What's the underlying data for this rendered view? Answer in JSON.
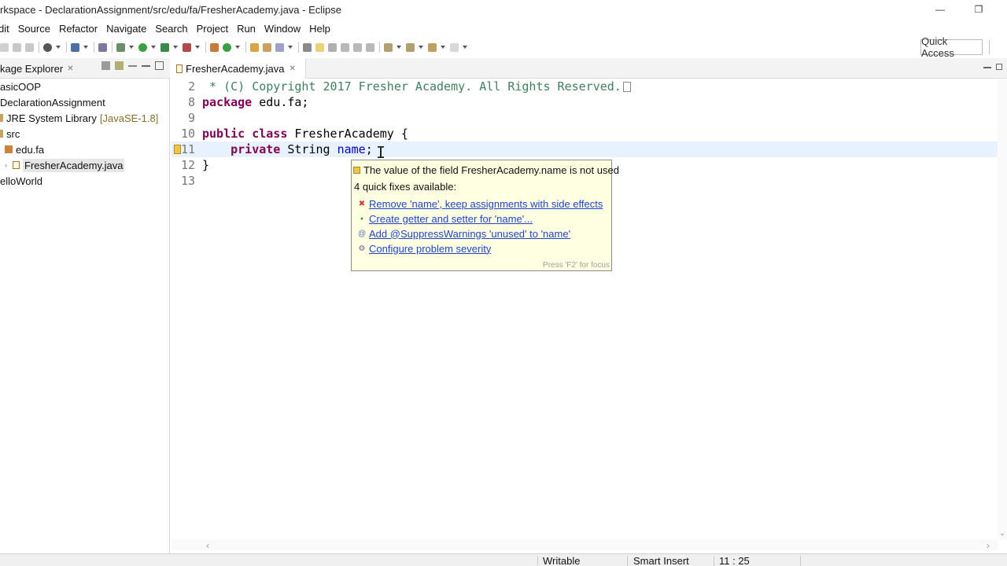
{
  "window": {
    "title": "rkspace - DeclarationAssignment/src/edu/fa/FresherAcademy.java - Eclipse",
    "minimize_glyph": "—",
    "restore_glyph": "❐"
  },
  "menu": [
    "dit",
    "Source",
    "Refactor",
    "Navigate",
    "Search",
    "Project",
    "Run",
    "Window",
    "Help"
  ],
  "toolbar": {
    "quick_access": "Quick Access"
  },
  "package_explorer": {
    "title": "kage Explorer",
    "close_glyph": "✕",
    "items": [
      {
        "label": "asicOOP",
        "extra": ""
      },
      {
        "label": "DeclarationAssignment",
        "extra": ""
      },
      {
        "label": "JRE System Library",
        "extra": "[JavaSE-1.8]"
      },
      {
        "label": "src",
        "extra": ""
      },
      {
        "label": "edu.fa",
        "extra": ""
      },
      {
        "label": "FresherAcademy.java",
        "extra": ""
      },
      {
        "label": "elloWorld",
        "extra": ""
      }
    ]
  },
  "editor": {
    "tab_label": "FresherAcademy.java",
    "close_glyph": "✕",
    "lines": [
      {
        "num": "2",
        "text": " * (C) Copyright 2017 Fresher Academy. All Rights Reserved."
      },
      {
        "num": "8",
        "kw": "package",
        "text": " edu.fa;"
      },
      {
        "num": "9",
        "text": ""
      },
      {
        "num": "10",
        "kw": "public class",
        "text": " FresherAcademy {"
      },
      {
        "num": "11",
        "kw": "private",
        "text": " String ",
        "field": "name",
        "after": ";"
      },
      {
        "num": "12",
        "text": "}"
      },
      {
        "num": "13",
        "text": ""
      }
    ]
  },
  "hover": {
    "message": "The value of the field FresherAcademy.name is not used",
    "count": "4 quick fixes available:",
    "fixes": [
      {
        "label": "Remove 'name', keep assignments with side effects",
        "icon": "remove-icon",
        "glyph": "✖",
        "color": "#d23a3a"
      },
      {
        "label": "Create getter and setter for 'name'...",
        "icon": "method-icon",
        "glyph": "●",
        "color": "#3aa043"
      },
      {
        "label": "Add @SuppressWarnings 'unused' to 'name'",
        "icon": "annotation-icon",
        "glyph": "@",
        "color": "#5a6fb0"
      },
      {
        "label": "Configure problem severity",
        "icon": "settings-icon",
        "glyph": "⚙",
        "color": "#7a5a9a"
      }
    ],
    "footer": "Press 'F2' for focus"
  },
  "status": {
    "writable": "Writable",
    "insert_mode": "Smart Insert",
    "position": "11 : 25"
  }
}
